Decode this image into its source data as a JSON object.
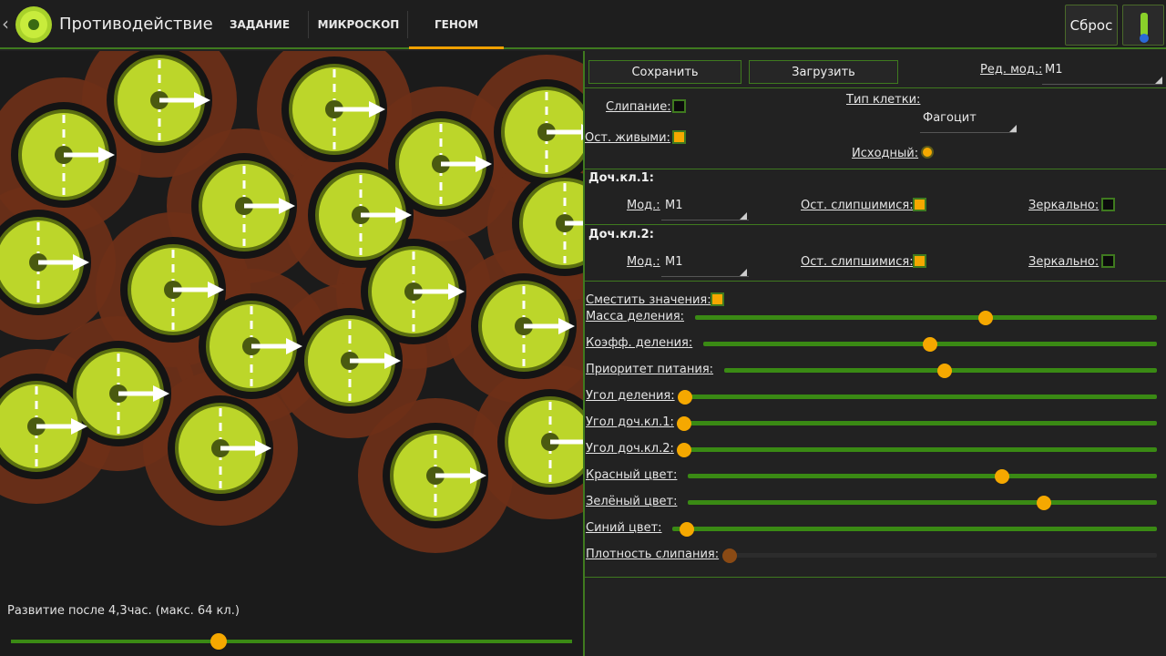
{
  "app": {
    "title": "Противодействие"
  },
  "tabs": [
    {
      "label": "ЗАДАНИЕ"
    },
    {
      "label": "МИКРОСКОП"
    },
    {
      "label": "ГЕНОМ"
    }
  ],
  "toolbar": {
    "reset_label": "Сброс",
    "thermo_icon": "thermometer-icon"
  },
  "simulation": {
    "caption": "Развитие после 4,3час. (макс. 64 кл.)",
    "progress_fraction": 0.37
  },
  "genome": {
    "save_label": "Сохранить",
    "load_label": "Загрузить",
    "edit_mode_label": "Ред. мод.:",
    "edit_mode_value": "M1",
    "sticking_label": "Слипание:",
    "sticking_checked": false,
    "stay_alive_label": "Ост. живыми:",
    "stay_alive_checked": true,
    "cell_type_label": "Тип клетки:",
    "cell_type_value": "Фагоцит",
    "initial_label": "Исходный:",
    "initial_selected": true,
    "child1": {
      "title": "Доч.кл.1:",
      "mode_label": "Мод.:",
      "mode_value": "M1",
      "stay_stuck_label": "Ост. слипшимися:",
      "stay_stuck_checked": true,
      "mirror_label": "Зеркально:",
      "mirror_checked": false
    },
    "child2": {
      "title": "Доч.кл.2:",
      "mode_label": "Мод.:",
      "mode_value": "M1",
      "stay_stuck_label": "Ост. слипшимися:",
      "stay_stuck_checked": true,
      "mirror_label": "Зеркально:",
      "mirror_checked": false
    },
    "shift_values_label": "Сместить значения:",
    "shift_values_checked": true,
    "sliders": [
      {
        "label": "Масса деления:",
        "value": 0.63,
        "enabled": true
      },
      {
        "label": "Коэфф. деления:",
        "value": 0.5,
        "enabled": true
      },
      {
        "label": "Приоритет питания:",
        "value": 0.51,
        "enabled": true
      },
      {
        "label": "Угол деления:",
        "value": 0.0,
        "enabled": true
      },
      {
        "label": "Угол доч.кл.1:",
        "value": 0.0,
        "enabled": true
      },
      {
        "label": "Угол доч.кл.2:",
        "value": 0.0,
        "enabled": true
      },
      {
        "label": "Красный цвет:",
        "value": 0.67,
        "enabled": true
      },
      {
        "label": "Зелёный цвет:",
        "value": 0.76,
        "enabled": true
      },
      {
        "label": "Синий цвет:",
        "value": 0.03,
        "enabled": true
      },
      {
        "label": "Плотность слипания:",
        "value": 0.0,
        "enabled": false
      }
    ]
  },
  "colors": {
    "accent": "#f5a800",
    "track": "#3a8a14",
    "cell_fill": "#bcd62a",
    "cell_halo": "#6e3018"
  }
}
